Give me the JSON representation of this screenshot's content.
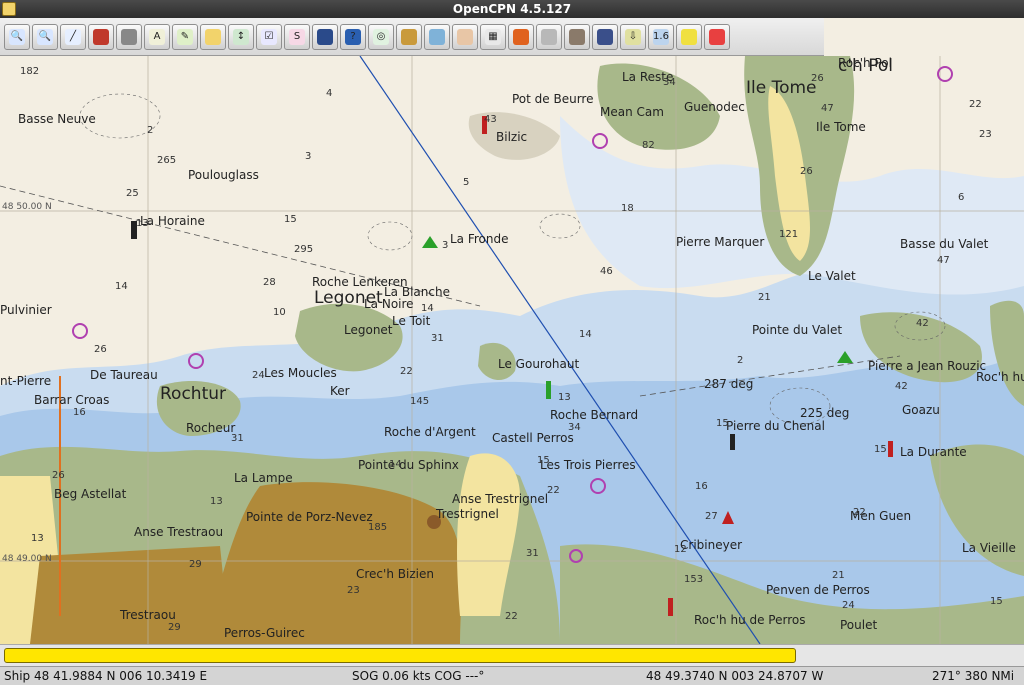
{
  "window": {
    "title": "OpenCPN 4.5.127"
  },
  "toolbar": {
    "buttons": [
      {
        "name": "zoom-in-button",
        "icon": "zoom-in-icon",
        "glyph": "🔍",
        "bg": "#d8e6ff"
      },
      {
        "name": "zoom-out-button",
        "icon": "zoom-out-icon",
        "glyph": "🔍",
        "bg": "#d8e6ff"
      },
      {
        "name": "route-button",
        "icon": "route-icon",
        "glyph": "╱",
        "bg": "#e6efff"
      },
      {
        "name": "waypoint-button",
        "icon": "waypoint-icon",
        "glyph": "",
        "bg": "#c0392b"
      },
      {
        "name": "measure-button",
        "icon": "measure-icon",
        "glyph": "",
        "bg": "#888888"
      },
      {
        "name": "text-button",
        "icon": "text-icon",
        "glyph": "A",
        "bg": "#f0f0d8"
      },
      {
        "name": "draw-button",
        "icon": "pencil-icon",
        "glyph": "✎",
        "bg": "#dff0c8"
      },
      {
        "name": "layers-button",
        "icon": "layers-icon",
        "glyph": "",
        "bg": "#f2d36b"
      },
      {
        "name": "track-button",
        "icon": "track-icon",
        "glyph": "↕",
        "bg": "#cfe8cf"
      },
      {
        "name": "route-manager-button",
        "icon": "route-manager-icon",
        "glyph": "☑",
        "bg": "#e8e8ff"
      },
      {
        "name": "curve-button",
        "icon": "curve-icon",
        "glyph": "S",
        "bg": "#f6d8e6"
      },
      {
        "name": "depth-button",
        "icon": "depth-icon",
        "glyph": "",
        "bg": "#2a4a8a"
      },
      {
        "name": "help-button",
        "icon": "help-icon",
        "glyph": "?",
        "bg": "#2a5fb0"
      },
      {
        "name": "target-button",
        "icon": "target-icon",
        "glyph": "◎",
        "bg": "#e0f2e0"
      },
      {
        "name": "tides-button",
        "icon": "tides-icon",
        "glyph": "",
        "bg": "#c99a3c"
      },
      {
        "name": "colors-button",
        "icon": "palette-icon",
        "glyph": "",
        "bg": "#7fb2d8"
      },
      {
        "name": "chart-button",
        "icon": "chart-icon",
        "glyph": "",
        "bg": "#e8c6a6"
      },
      {
        "name": "grid-button",
        "icon": "grid-icon",
        "glyph": "▦",
        "bg": "#e8e8e8"
      },
      {
        "name": "settings-button",
        "icon": "settings-icon",
        "glyph": "",
        "bg": "#e0621e"
      },
      {
        "name": "ais-button",
        "icon": "ais-icon",
        "glyph": "",
        "bg": "#b8b8b8"
      },
      {
        "name": "dog-button",
        "icon": "dog-icon",
        "glyph": "",
        "bg": "#8a7a6a"
      },
      {
        "name": "globe-button",
        "icon": "globe-icon",
        "glyph": "",
        "bg": "#3a4f8a"
      },
      {
        "name": "download-button",
        "icon": "download-icon",
        "glyph": "⇩",
        "bg": "#e0e0a0"
      },
      {
        "name": "version-button",
        "icon": "version-icon",
        "glyph": "1.6",
        "bg": "#bcd4ee"
      },
      {
        "name": "ruler-button",
        "icon": "ruler-icon",
        "glyph": "",
        "bg": "#f0e040"
      },
      {
        "name": "lifebuoy-button",
        "icon": "lifebuoy-icon",
        "glyph": "",
        "bg": "#e84040"
      }
    ]
  },
  "chart": {
    "lat_labels": [
      "48 50.00 N",
      "48 49.00 N"
    ],
    "places": [
      {
        "name": "place-ile-tome",
        "text": "Ile Tome",
        "big": true
      },
      {
        "name": "place-legonet",
        "text": "Legonet",
        "big": true
      },
      {
        "name": "place-rochtur",
        "text": "Rochtur",
        "big": true
      },
      {
        "name": "place-roch-pol-big",
        "text": "c'h Pol",
        "big": true
      },
      {
        "name": "place-la-reste",
        "text": "La Reste"
      },
      {
        "name": "place-pot-de-beurre",
        "text": "Pot de Beurre"
      },
      {
        "name": "place-mean-cam",
        "text": "Mean Cam"
      },
      {
        "name": "place-guenodec",
        "text": "Guenodec"
      },
      {
        "name": "place-bilzic",
        "text": "Bilzic"
      },
      {
        "name": "place-basse-neuve",
        "text": "Basse Neuve"
      },
      {
        "name": "place-poulouglass",
        "text": "Poulouglass"
      },
      {
        "name": "place-la-horaine",
        "text": "La Horaine"
      },
      {
        "name": "place-la-fronde",
        "text": "La Fronde"
      },
      {
        "name": "place-pierre-marquer",
        "text": "Pierre Marquer"
      },
      {
        "name": "place-roch-pol",
        "text": "Roc'h Pol"
      },
      {
        "name": "place-ile-tome-small",
        "text": "Ile Tome"
      },
      {
        "name": "place-basse-du-valet",
        "text": "Basse du Valet"
      },
      {
        "name": "place-le-valet",
        "text": "Le Valet"
      },
      {
        "name": "place-roche-lenkeren",
        "text": "Roche Lenkeren"
      },
      {
        "name": "place-la-blanche",
        "text": "La Blanche"
      },
      {
        "name": "place-la-noire",
        "text": "La Noire"
      },
      {
        "name": "place-le-toit",
        "text": "Le Toit"
      },
      {
        "name": "place-legonet-small",
        "text": "Legonet"
      },
      {
        "name": "place-pulvinier",
        "text": "Pulvinier"
      },
      {
        "name": "place-pointe-du-valet",
        "text": "Pointe du Valet"
      },
      {
        "name": "place-pierre-a-jean-rouzic",
        "text": "Pierre a Jean Rouzic"
      },
      {
        "name": "place-roch-hu",
        "text": "Roc'h hu"
      },
      {
        "name": "place-le-gourohaut",
        "text": "Le Gourohaut"
      },
      {
        "name": "place-de-taureau",
        "text": "De Taureau"
      },
      {
        "name": "place-les-moucles",
        "text": "Les Moucles"
      },
      {
        "name": "place-ker",
        "text": "Ker"
      },
      {
        "name": "place-pierre",
        "text": "nt-Pierre"
      },
      {
        "name": "place-barrar-croas",
        "text": "Barrar Croas"
      },
      {
        "name": "place-rocheur",
        "text": "Rocheur"
      },
      {
        "name": "place-roche-bernard",
        "text": "Roche Bernard"
      },
      {
        "name": "place-pierre-du-chenal",
        "text": "Pierre du Chenal"
      },
      {
        "name": "place-goazu",
        "text": "Goazu"
      },
      {
        "name": "place-roche-d-argent",
        "text": "Roche d'Argent"
      },
      {
        "name": "place-castell-perros",
        "text": "Castell Perros"
      },
      {
        "name": "place-pointe-du-sphinx",
        "text": "Pointe du Sphinx"
      },
      {
        "name": "place-les-trois-pierres",
        "text": "Les Trois Pierres"
      },
      {
        "name": "place-la-durante",
        "text": "La Durante"
      },
      {
        "name": "place-la-lampe",
        "text": "La Lampe"
      },
      {
        "name": "place-beg-astellat",
        "text": "Beg Astellat"
      },
      {
        "name": "place-anse-trestrignel",
        "text": "Anse Trestrignel"
      },
      {
        "name": "place-trestrignel",
        "text": "Trestrignel"
      },
      {
        "name": "place-anse-trestraou",
        "text": "Anse Trestraou"
      },
      {
        "name": "place-pointe-de-porz-nevez",
        "text": "Pointe de Porz-Nevez"
      },
      {
        "name": "place-men-guen",
        "text": "Men Guen"
      },
      {
        "name": "place-la-vieille",
        "text": "La Vieille"
      },
      {
        "name": "place-cribineyer",
        "text": "Cribineyer"
      },
      {
        "name": "place-crec-h-bizien",
        "text": "Crec'h Bizien"
      },
      {
        "name": "place-penven-de-perros",
        "text": "Penven de Perros"
      },
      {
        "name": "place-trestraou",
        "text": "Trestraou"
      },
      {
        "name": "place-roch-hu-de-perros",
        "text": "Roc'h hu de Perros"
      },
      {
        "name": "place-poulet",
        "text": "Poulet"
      },
      {
        "name": "place-perros-guirec",
        "text": "Perros-Guirec"
      }
    ],
    "bearings": [
      "287 deg",
      "225 deg"
    ],
    "depths": [
      "182",
      "265",
      "295",
      "31",
      "34",
      "27",
      "24",
      "23",
      "13",
      "10",
      "145",
      "22",
      "153",
      "47",
      "6",
      "14",
      "24",
      "14",
      "31",
      "34",
      "26",
      "47",
      "26",
      "31",
      "185",
      "22",
      "82",
      "121",
      "42",
      "16",
      "13",
      "23",
      "43",
      "18",
      "21",
      "42",
      "26",
      "29",
      "4",
      "5",
      "46",
      "2",
      "15",
      "13",
      "29",
      "3",
      "3",
      "14",
      "15",
      "22",
      "15",
      "2",
      "15",
      "14",
      "13",
      "16",
      "21",
      "22",
      "25",
      "28",
      "22",
      "15",
      "12",
      "26"
    ]
  },
  "progress": {
    "fraction": 0.78
  },
  "status": {
    "ship": "Ship 48 41.9884 N   006 10.3419 E",
    "sog": "SOG 0.06 kts  COG ---°",
    "cursor": "48 49.3740 N   003 24.8707 W",
    "range": "271°  380 NMi"
  }
}
